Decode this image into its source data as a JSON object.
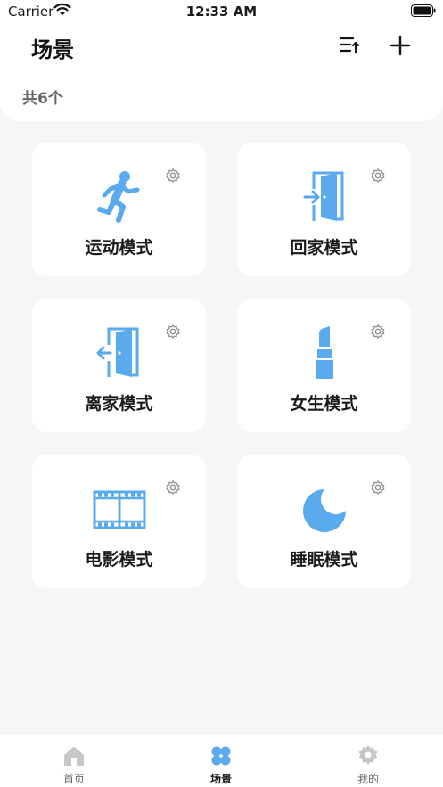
{
  "status_bar": {
    "carrier": "Carrier",
    "time": "12:33 AM"
  },
  "header": {
    "title": "场景",
    "count_text": "共6个"
  },
  "scenes": [
    {
      "label": "运动模式",
      "icon": "running-person-icon"
    },
    {
      "label": "回家模式",
      "icon": "door-enter-icon"
    },
    {
      "label": "离家模式",
      "icon": "door-exit-icon"
    },
    {
      "label": "女生模式",
      "icon": "lipstick-icon"
    },
    {
      "label": "电影模式",
      "icon": "film-strip-icon"
    },
    {
      "label": "睡眠模式",
      "icon": "crescent-moon-icon"
    }
  ],
  "tabbar": {
    "items": [
      {
        "label": "首页",
        "icon": "home-icon"
      },
      {
        "label": "场景",
        "icon": "clover-icon"
      },
      {
        "label": "我的",
        "icon": "gear-icon"
      }
    ],
    "active_index": 1
  },
  "colors": {
    "accent": "#5aaaee",
    "inactive": "#c7c7c7",
    "gear": "#8a8a8a"
  }
}
